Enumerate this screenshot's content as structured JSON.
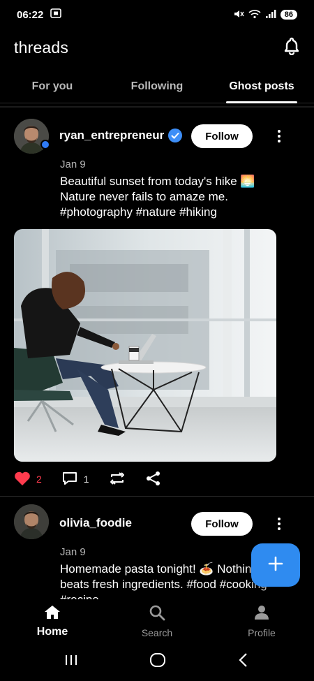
{
  "status_bar": {
    "time": "06:22",
    "battery": "86"
  },
  "header": {
    "title": "threads"
  },
  "tabs": [
    {
      "label": "For you",
      "active": false
    },
    {
      "label": "Following",
      "active": false
    },
    {
      "label": "Ghost posts",
      "active": true
    }
  ],
  "posts": [
    {
      "username": "ryan_entrepreneur",
      "verified": true,
      "follow_label": "Follow",
      "date": "Jan 9",
      "text_line1": "Beautiful sunset from today's hike 🌅",
      "text_line2": "Nature never fails to amaze me.",
      "text_line3": "#photography #nature #hiking",
      "likes": "2",
      "replies": "1"
    },
    {
      "username": "olivia_foodie",
      "verified": false,
      "follow_label": "Follow",
      "date": "Jan 9",
      "text_line1": "Homemade pasta tonight! 🍝 Nothing",
      "text_line2": "beats fresh ingredients. #food #cooking",
      "text_line3": "#recipe"
    }
  ],
  "bottom_nav": [
    {
      "label": "Home",
      "icon": "home-icon",
      "active": true
    },
    {
      "label": "Search",
      "icon": "search-icon",
      "active": false
    },
    {
      "label": "Profile",
      "icon": "profile-icon",
      "active": false
    }
  ],
  "colors": {
    "accent": "#2f8bf0",
    "like": "#ff3b4e",
    "verified": "#3d8ef7"
  }
}
